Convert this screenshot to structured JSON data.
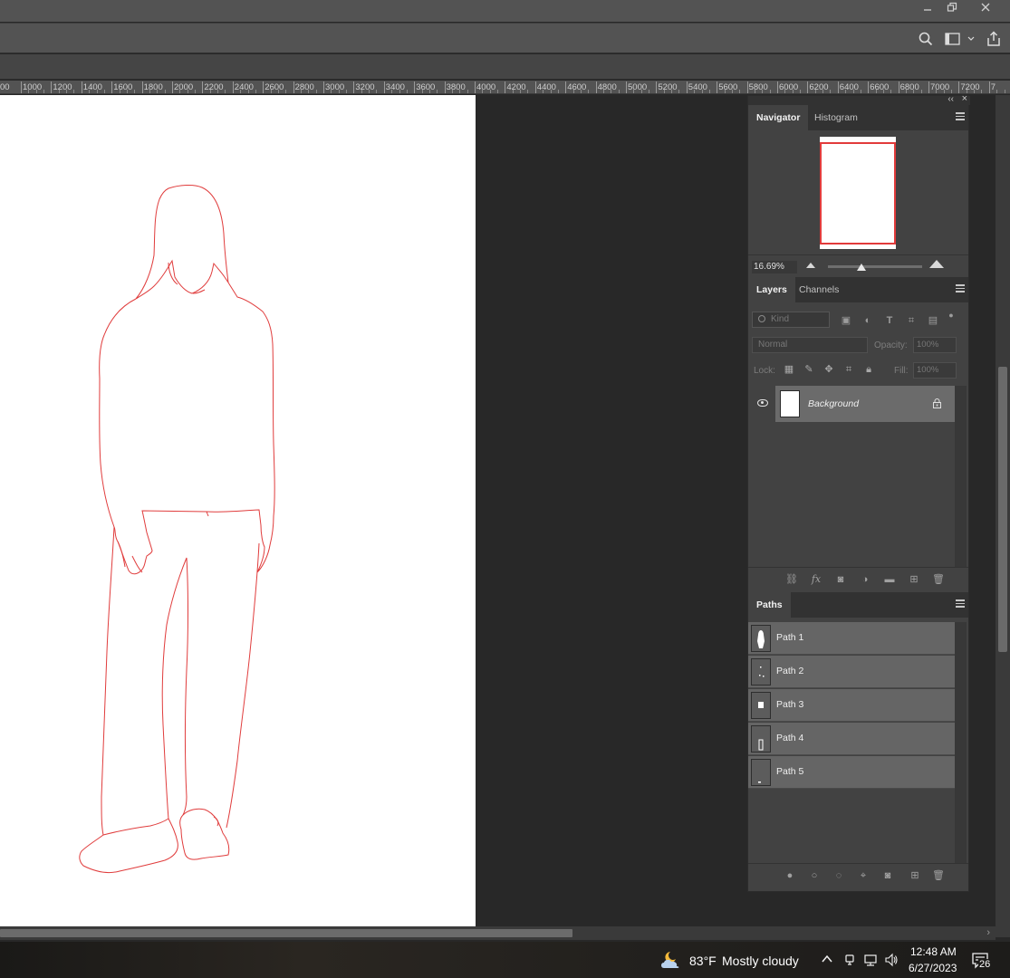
{
  "window": {
    "minimize_icon": "minimize-icon",
    "restore_icon": "restore-icon",
    "close_icon": "close-icon"
  },
  "optionsbar": {
    "search_icon": "search-icon",
    "workspace_icon": "workspace-icon",
    "share_icon": "share-icon"
  },
  "ruler": {
    "labels": [
      "00",
      "1000",
      "1200",
      "1400",
      "1600",
      "1800",
      "2000",
      "2200",
      "2400",
      "2600",
      "2800",
      "3000",
      "3200",
      "3400",
      "3600",
      "3800",
      "4000",
      "4200",
      "4400",
      "4600",
      "4800",
      "5000",
      "5200",
      "5400",
      "5600",
      "5800",
      "6000",
      "6200",
      "6400",
      "6600",
      "6800",
      "7000",
      "7200",
      "7"
    ]
  },
  "navigator": {
    "tabs": [
      "Navigator",
      "Histogram"
    ],
    "zoom": "16.69%"
  },
  "layers": {
    "tabs": [
      "Layers",
      "Channels"
    ],
    "kind_placeholder": "Kind",
    "blend_mode": "Normal",
    "opacity_label": "Opacity:",
    "opacity_value": "100%",
    "lock_label": "Lock:",
    "fill_label": "Fill:",
    "fill_value": "100%",
    "items": [
      {
        "name": "Background",
        "visible": true,
        "locked": true
      }
    ]
  },
  "paths": {
    "tab": "Paths",
    "items": [
      {
        "name": "Path 1"
      },
      {
        "name": "Path 2"
      },
      {
        "name": "Path 3"
      },
      {
        "name": "Path 4"
      },
      {
        "name": "Path 5"
      }
    ]
  },
  "taskbar": {
    "temperature": "83°F",
    "condition": "Mostly cloudy",
    "time": "12:48 AM",
    "date": "6/27/2023",
    "notification_count": "26"
  },
  "colors": {
    "path_stroke": "#e03c3c",
    "panel_bg": "#424242",
    "canvas_bg": "#282828"
  }
}
